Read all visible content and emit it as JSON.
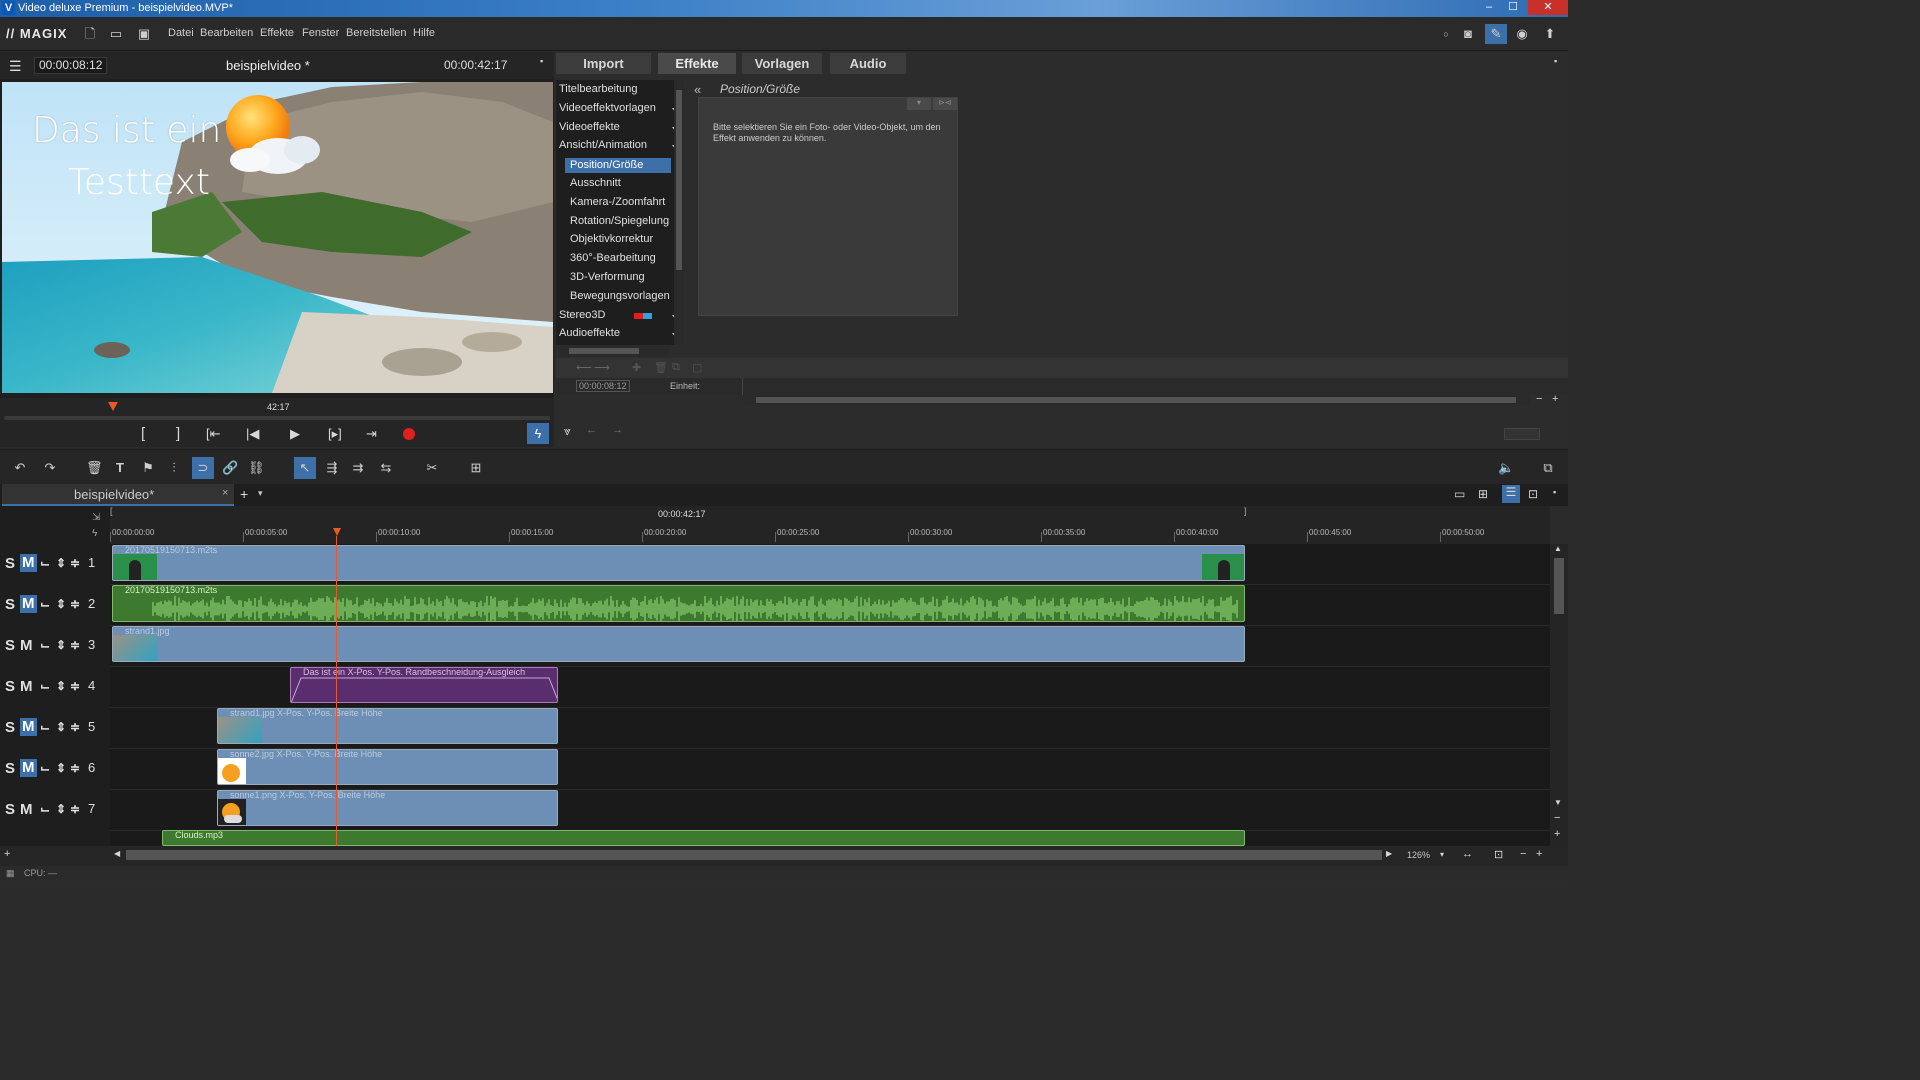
{
  "window": {
    "title": "Video deluxe Premium - beispielvideo.MVP*",
    "minimize": "–",
    "maximize": "☐",
    "close": "✕"
  },
  "menu": {
    "logo": "// MAGIX",
    "items": [
      "Datei",
      "Bearbeiten",
      "Effekte",
      "Fenster",
      "Bereitstellen",
      "Hilfe"
    ]
  },
  "preview": {
    "timecode_left": "00:00:08:12",
    "title": "beispielvideo *",
    "timecode_right": "00:00:42:17",
    "overlay_line1": "Das ist ein",
    "overlay_line2": "Testtext",
    "scrub_label": "42:17",
    "playhead_fraction": 0.2
  },
  "transport": {
    "mark_in": "[",
    "mark_out": "]"
  },
  "tabs": [
    "Import",
    "Effekte",
    "Vorlagen",
    "Audio"
  ],
  "active_tab": "Effekte",
  "effects": {
    "items": [
      {
        "label": "Titelbearbeitung",
        "sub": false,
        "expand": false
      },
      {
        "label": "Videoeffektvorlagen",
        "sub": false,
        "expand": true
      },
      {
        "label": "Videoeffekte",
        "sub": false,
        "expand": true
      },
      {
        "label": "Ansicht/Animation",
        "sub": false,
        "expand": true
      },
      {
        "label": "Position/Größe",
        "sub": true,
        "selected": true
      },
      {
        "label": "Ausschnitt",
        "sub": true
      },
      {
        "label": "Kamera-/Zoomfahrt",
        "sub": true
      },
      {
        "label": "Rotation/Spiegelung",
        "sub": true
      },
      {
        "label": "Objektivkorrektur",
        "sub": true
      },
      {
        "label": "360°-Bearbeitung",
        "sub": true
      },
      {
        "label": "3D-Verformung",
        "sub": true
      },
      {
        "label": "Bewegungsvorlagen",
        "sub": true
      },
      {
        "label": "Stereo3D",
        "sub": false,
        "expand": true
      },
      {
        "label": "Audioeffekte",
        "sub": false,
        "expand": true
      }
    ],
    "panel_title": "Position/Größe",
    "panel_message": "Bitte selektieren Sie ein Foto- oder Video-Objekt, um den Effekt anwenden zu können.",
    "kf_time": "00:00:08:12",
    "kf_unit_label": "Einheit:"
  },
  "project": {
    "tab": "beispielvideo*",
    "close": "×",
    "add": "+"
  },
  "ruler": {
    "total": "00:00:42:17",
    "ticks": [
      "00:00:00:00",
      "00:00:05:00",
      "00:00:10:00",
      "00:00:15:00",
      "00:00:20:00",
      "00:00:25:00",
      "00:00:30:00",
      "00:00:35:00",
      "00:00:40:00",
      "00:00:45:00",
      "00:00:50:00"
    ]
  },
  "tracks": [
    {
      "num": "1",
      "s": "S",
      "m": "M",
      "mActive": true
    },
    {
      "num": "2",
      "s": "S",
      "m": "M",
      "mActive": true
    },
    {
      "num": "3",
      "s": "S",
      "m": "M",
      "mActive": false
    },
    {
      "num": "4",
      "s": "S",
      "m": "M",
      "mActive": false
    },
    {
      "num": "5",
      "s": "S",
      "m": "M",
      "mActive": true
    },
    {
      "num": "6",
      "s": "S",
      "m": "M",
      "mActive": true
    },
    {
      "num": "7",
      "s": "S",
      "m": "M",
      "mActive": false
    }
  ],
  "clips": {
    "c1": "20170519150713.m2ts",
    "c2": "20170519150713.m2ts",
    "c3": "strand1.jpg",
    "c4": "Das ist ein   X-Pos.  Y-Pos.  Randbeschneidung-Ausgleich",
    "c5": "strand1.jpg  X-Pos.  Y-Pos.  Breite  Höhe",
    "c6": "sonne2.jpg  X-Pos.  Y-Pos.  Breite  Höhe",
    "c7": "sonne1.png  X-Pos.  Y-Pos.  Breite  Höhe",
    "c8": "Clouds.mp3"
  },
  "zoom": "126%",
  "status": "CPU: —",
  "colors": {
    "accent": "#3d6fa8",
    "record": "#e02020",
    "playhead": "#e85a2a"
  }
}
